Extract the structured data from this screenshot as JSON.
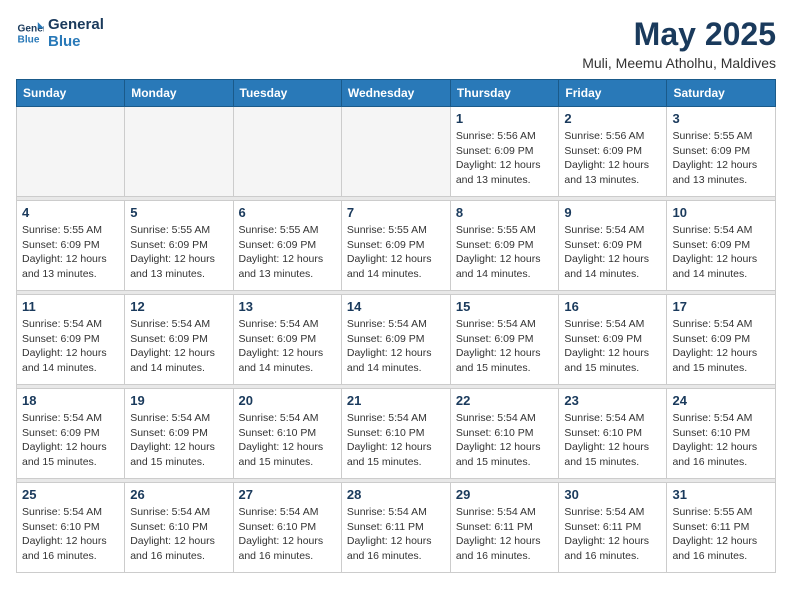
{
  "header": {
    "logo_line1": "General",
    "logo_line2": "Blue",
    "month": "May 2025",
    "location": "Muli, Meemu Atholhu, Maldives"
  },
  "days_of_week": [
    "Sunday",
    "Monday",
    "Tuesday",
    "Wednesday",
    "Thursday",
    "Friday",
    "Saturday"
  ],
  "weeks": [
    [
      {
        "day": "",
        "empty": true
      },
      {
        "day": "",
        "empty": true
      },
      {
        "day": "",
        "empty": true
      },
      {
        "day": "",
        "empty": true
      },
      {
        "day": "1",
        "sunrise": "5:56 AM",
        "sunset": "6:09 PM",
        "daylight": "12 hours and 13 minutes."
      },
      {
        "day": "2",
        "sunrise": "5:56 AM",
        "sunset": "6:09 PM",
        "daylight": "12 hours and 13 minutes."
      },
      {
        "day": "3",
        "sunrise": "5:55 AM",
        "sunset": "6:09 PM",
        "daylight": "12 hours and 13 minutes."
      }
    ],
    [
      {
        "day": "4",
        "sunrise": "5:55 AM",
        "sunset": "6:09 PM",
        "daylight": "12 hours and 13 minutes."
      },
      {
        "day": "5",
        "sunrise": "5:55 AM",
        "sunset": "6:09 PM",
        "daylight": "12 hours and 13 minutes."
      },
      {
        "day": "6",
        "sunrise": "5:55 AM",
        "sunset": "6:09 PM",
        "daylight": "12 hours and 13 minutes."
      },
      {
        "day": "7",
        "sunrise": "5:55 AM",
        "sunset": "6:09 PM",
        "daylight": "12 hours and 14 minutes."
      },
      {
        "day": "8",
        "sunrise": "5:55 AM",
        "sunset": "6:09 PM",
        "daylight": "12 hours and 14 minutes."
      },
      {
        "day": "9",
        "sunrise": "5:54 AM",
        "sunset": "6:09 PM",
        "daylight": "12 hours and 14 minutes."
      },
      {
        "day": "10",
        "sunrise": "5:54 AM",
        "sunset": "6:09 PM",
        "daylight": "12 hours and 14 minutes."
      }
    ],
    [
      {
        "day": "11",
        "sunrise": "5:54 AM",
        "sunset": "6:09 PM",
        "daylight": "12 hours and 14 minutes."
      },
      {
        "day": "12",
        "sunrise": "5:54 AM",
        "sunset": "6:09 PM",
        "daylight": "12 hours and 14 minutes."
      },
      {
        "day": "13",
        "sunrise": "5:54 AM",
        "sunset": "6:09 PM",
        "daylight": "12 hours and 14 minutes."
      },
      {
        "day": "14",
        "sunrise": "5:54 AM",
        "sunset": "6:09 PM",
        "daylight": "12 hours and 14 minutes."
      },
      {
        "day": "15",
        "sunrise": "5:54 AM",
        "sunset": "6:09 PM",
        "daylight": "12 hours and 15 minutes."
      },
      {
        "day": "16",
        "sunrise": "5:54 AM",
        "sunset": "6:09 PM",
        "daylight": "12 hours and 15 minutes."
      },
      {
        "day": "17",
        "sunrise": "5:54 AM",
        "sunset": "6:09 PM",
        "daylight": "12 hours and 15 minutes."
      }
    ],
    [
      {
        "day": "18",
        "sunrise": "5:54 AM",
        "sunset": "6:09 PM",
        "daylight": "12 hours and 15 minutes."
      },
      {
        "day": "19",
        "sunrise": "5:54 AM",
        "sunset": "6:09 PM",
        "daylight": "12 hours and 15 minutes."
      },
      {
        "day": "20",
        "sunrise": "5:54 AM",
        "sunset": "6:10 PM",
        "daylight": "12 hours and 15 minutes."
      },
      {
        "day": "21",
        "sunrise": "5:54 AM",
        "sunset": "6:10 PM",
        "daylight": "12 hours and 15 minutes."
      },
      {
        "day": "22",
        "sunrise": "5:54 AM",
        "sunset": "6:10 PM",
        "daylight": "12 hours and 15 minutes."
      },
      {
        "day": "23",
        "sunrise": "5:54 AM",
        "sunset": "6:10 PM",
        "daylight": "12 hours and 15 minutes."
      },
      {
        "day": "24",
        "sunrise": "5:54 AM",
        "sunset": "6:10 PM",
        "daylight": "12 hours and 16 minutes."
      }
    ],
    [
      {
        "day": "25",
        "sunrise": "5:54 AM",
        "sunset": "6:10 PM",
        "daylight": "12 hours and 16 minutes."
      },
      {
        "day": "26",
        "sunrise": "5:54 AM",
        "sunset": "6:10 PM",
        "daylight": "12 hours and 16 minutes."
      },
      {
        "day": "27",
        "sunrise": "5:54 AM",
        "sunset": "6:10 PM",
        "daylight": "12 hours and 16 minutes."
      },
      {
        "day": "28",
        "sunrise": "5:54 AM",
        "sunset": "6:11 PM",
        "daylight": "12 hours and 16 minutes."
      },
      {
        "day": "29",
        "sunrise": "5:54 AM",
        "sunset": "6:11 PM",
        "daylight": "12 hours and 16 minutes."
      },
      {
        "day": "30",
        "sunrise": "5:54 AM",
        "sunset": "6:11 PM",
        "daylight": "12 hours and 16 minutes."
      },
      {
        "day": "31",
        "sunrise": "5:55 AM",
        "sunset": "6:11 PM",
        "daylight": "12 hours and 16 minutes."
      }
    ]
  ],
  "labels": {
    "sunrise": "Sunrise:",
    "sunset": "Sunset:",
    "daylight": "Daylight:"
  }
}
